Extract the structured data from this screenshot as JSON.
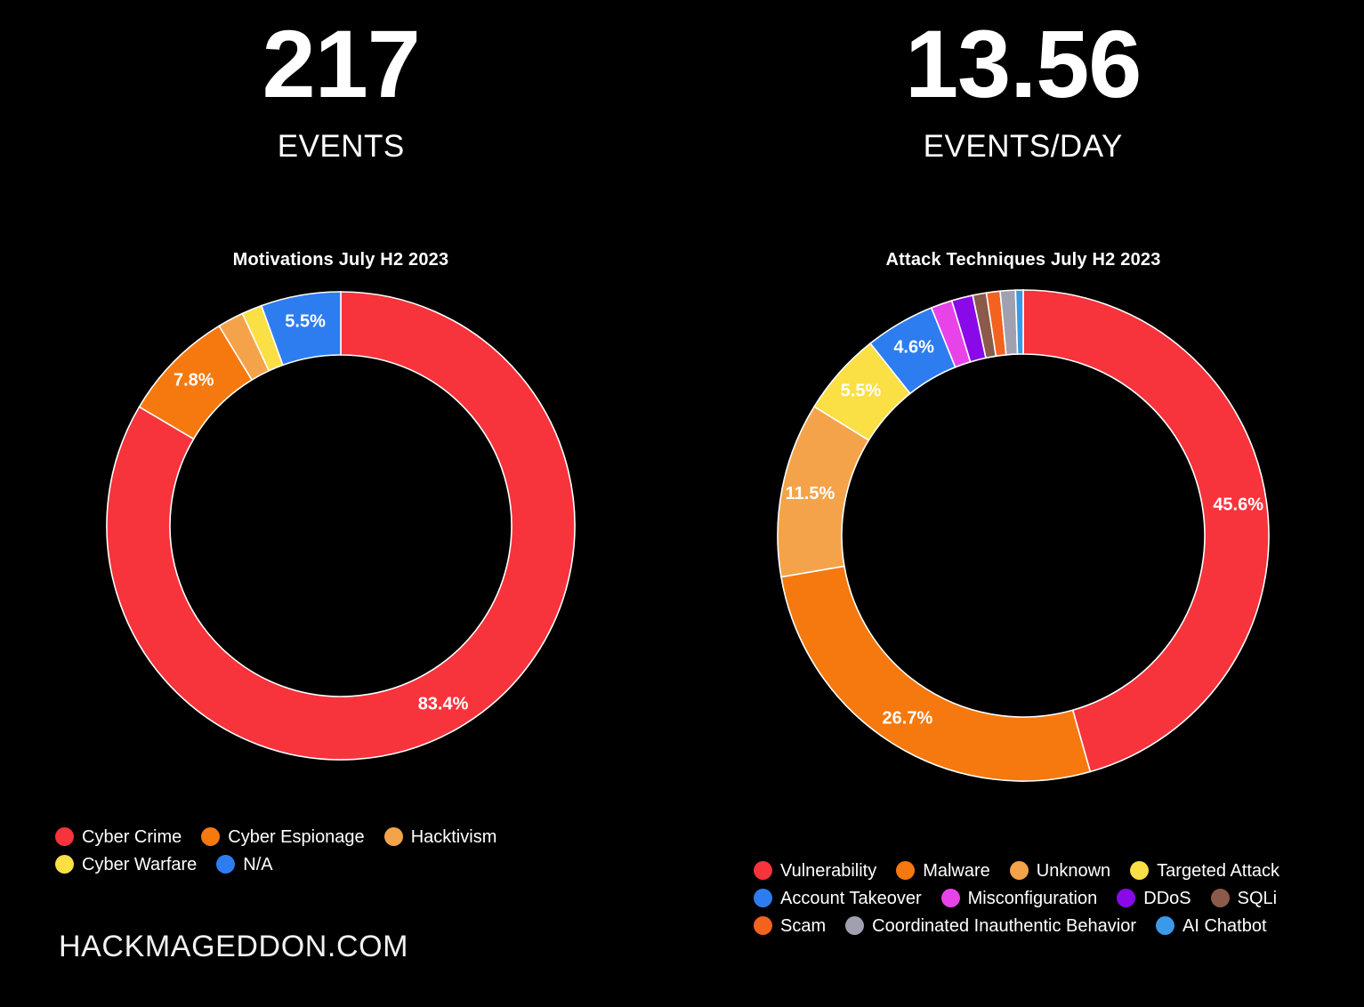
{
  "background_color": "#000000",
  "kpis": [
    {
      "value": "217",
      "label": "EVENTS"
    },
    {
      "value": "13.56",
      "label": "EVENTS/DAY"
    }
  ],
  "brand": "HACKMAGEDDON.COM",
  "chart_data": [
    {
      "type": "pie",
      "variant": "donut",
      "title": "Motivations July H2 2023",
      "xlabel": "",
      "ylabel": "",
      "legend_position": "bottom-left",
      "start_angle_deg": 0,
      "direction": "clockwise",
      "total_events": 217,
      "categories": [
        "Cyber Crime",
        "Cyber Espionage",
        "Hacktivism",
        "Cyber Warfare",
        "N/A"
      ],
      "values": [
        83.4,
        7.8,
        1.8,
        1.4,
        5.5
      ],
      "value_labels": [
        "83.4%",
        "7.8%",
        "",
        "",
        "5.5%"
      ],
      "shown_labels": [
        "83.4%",
        "7.8%",
        "5.5%"
      ],
      "colors": [
        "#F7333C",
        "#F5790E",
        "#F5A34A",
        "#FADF45",
        "#2D7DF0"
      ],
      "legend": [
        {
          "label": "Cyber Crime",
          "color": "#F7333C"
        },
        {
          "label": "Cyber Espionage",
          "color": "#F5790E"
        },
        {
          "label": "Hacktivism",
          "color": "#F5A34A"
        },
        {
          "label": "Cyber Warfare",
          "color": "#FADF45"
        },
        {
          "label": "N/A",
          "color": "#2D7DF0"
        }
      ]
    },
    {
      "type": "pie",
      "variant": "donut",
      "title": "Attack Techniques July H2 2023",
      "xlabel": "",
      "ylabel": "",
      "legend_position": "bottom-left",
      "start_angle_deg": 0,
      "direction": "clockwise",
      "categories": [
        "Vulnerability",
        "Malware",
        "Unknown",
        "Targeted Attack",
        "Account Takeover",
        "Misconfiguration",
        "DDoS",
        "SQLi",
        "Scam",
        "Coordinated Inauthentic Behavior",
        "AI Chatbot"
      ],
      "values": [
        45.6,
        26.7,
        11.5,
        5.5,
        4.6,
        1.4,
        1.4,
        0.9,
        0.9,
        1.0,
        0.5
      ],
      "value_labels": [
        "45.6%",
        "26.7%",
        "11.5%",
        "5.5%",
        "4.6%",
        "",
        "",
        "",
        "",
        "",
        ""
      ],
      "shown_labels": [
        "45.6%",
        "26.7%",
        "11.5%",
        "5.5%",
        "4.6%"
      ],
      "colors": [
        "#F7333C",
        "#F5790E",
        "#F5A34A",
        "#FADF45",
        "#2D7DF0",
        "#E843E8",
        "#8A09E8",
        "#8B5A4A",
        "#F4621F",
        "#A0A0B0",
        "#3B9AE8"
      ],
      "legend": [
        {
          "label": "Vulnerability",
          "color": "#F7333C"
        },
        {
          "label": "Malware",
          "color": "#F5790E"
        },
        {
          "label": "Unknown",
          "color": "#F5A34A"
        },
        {
          "label": "Targeted Attack",
          "color": "#FADF45"
        },
        {
          "label": "Account Takeover",
          "color": "#2D7DF0"
        },
        {
          "label": "Misconfiguration",
          "color": "#E843E8"
        },
        {
          "label": "DDoS",
          "color": "#8A09E8"
        },
        {
          "label": "SQLi",
          "color": "#8B5A4A"
        },
        {
          "label": "Scam",
          "color": "#F4621F"
        },
        {
          "label": "Coordinated Inauthentic Behavior",
          "color": "#A0A0B0"
        },
        {
          "label": "AI Chatbot",
          "color": "#3B9AE8"
        }
      ]
    }
  ]
}
